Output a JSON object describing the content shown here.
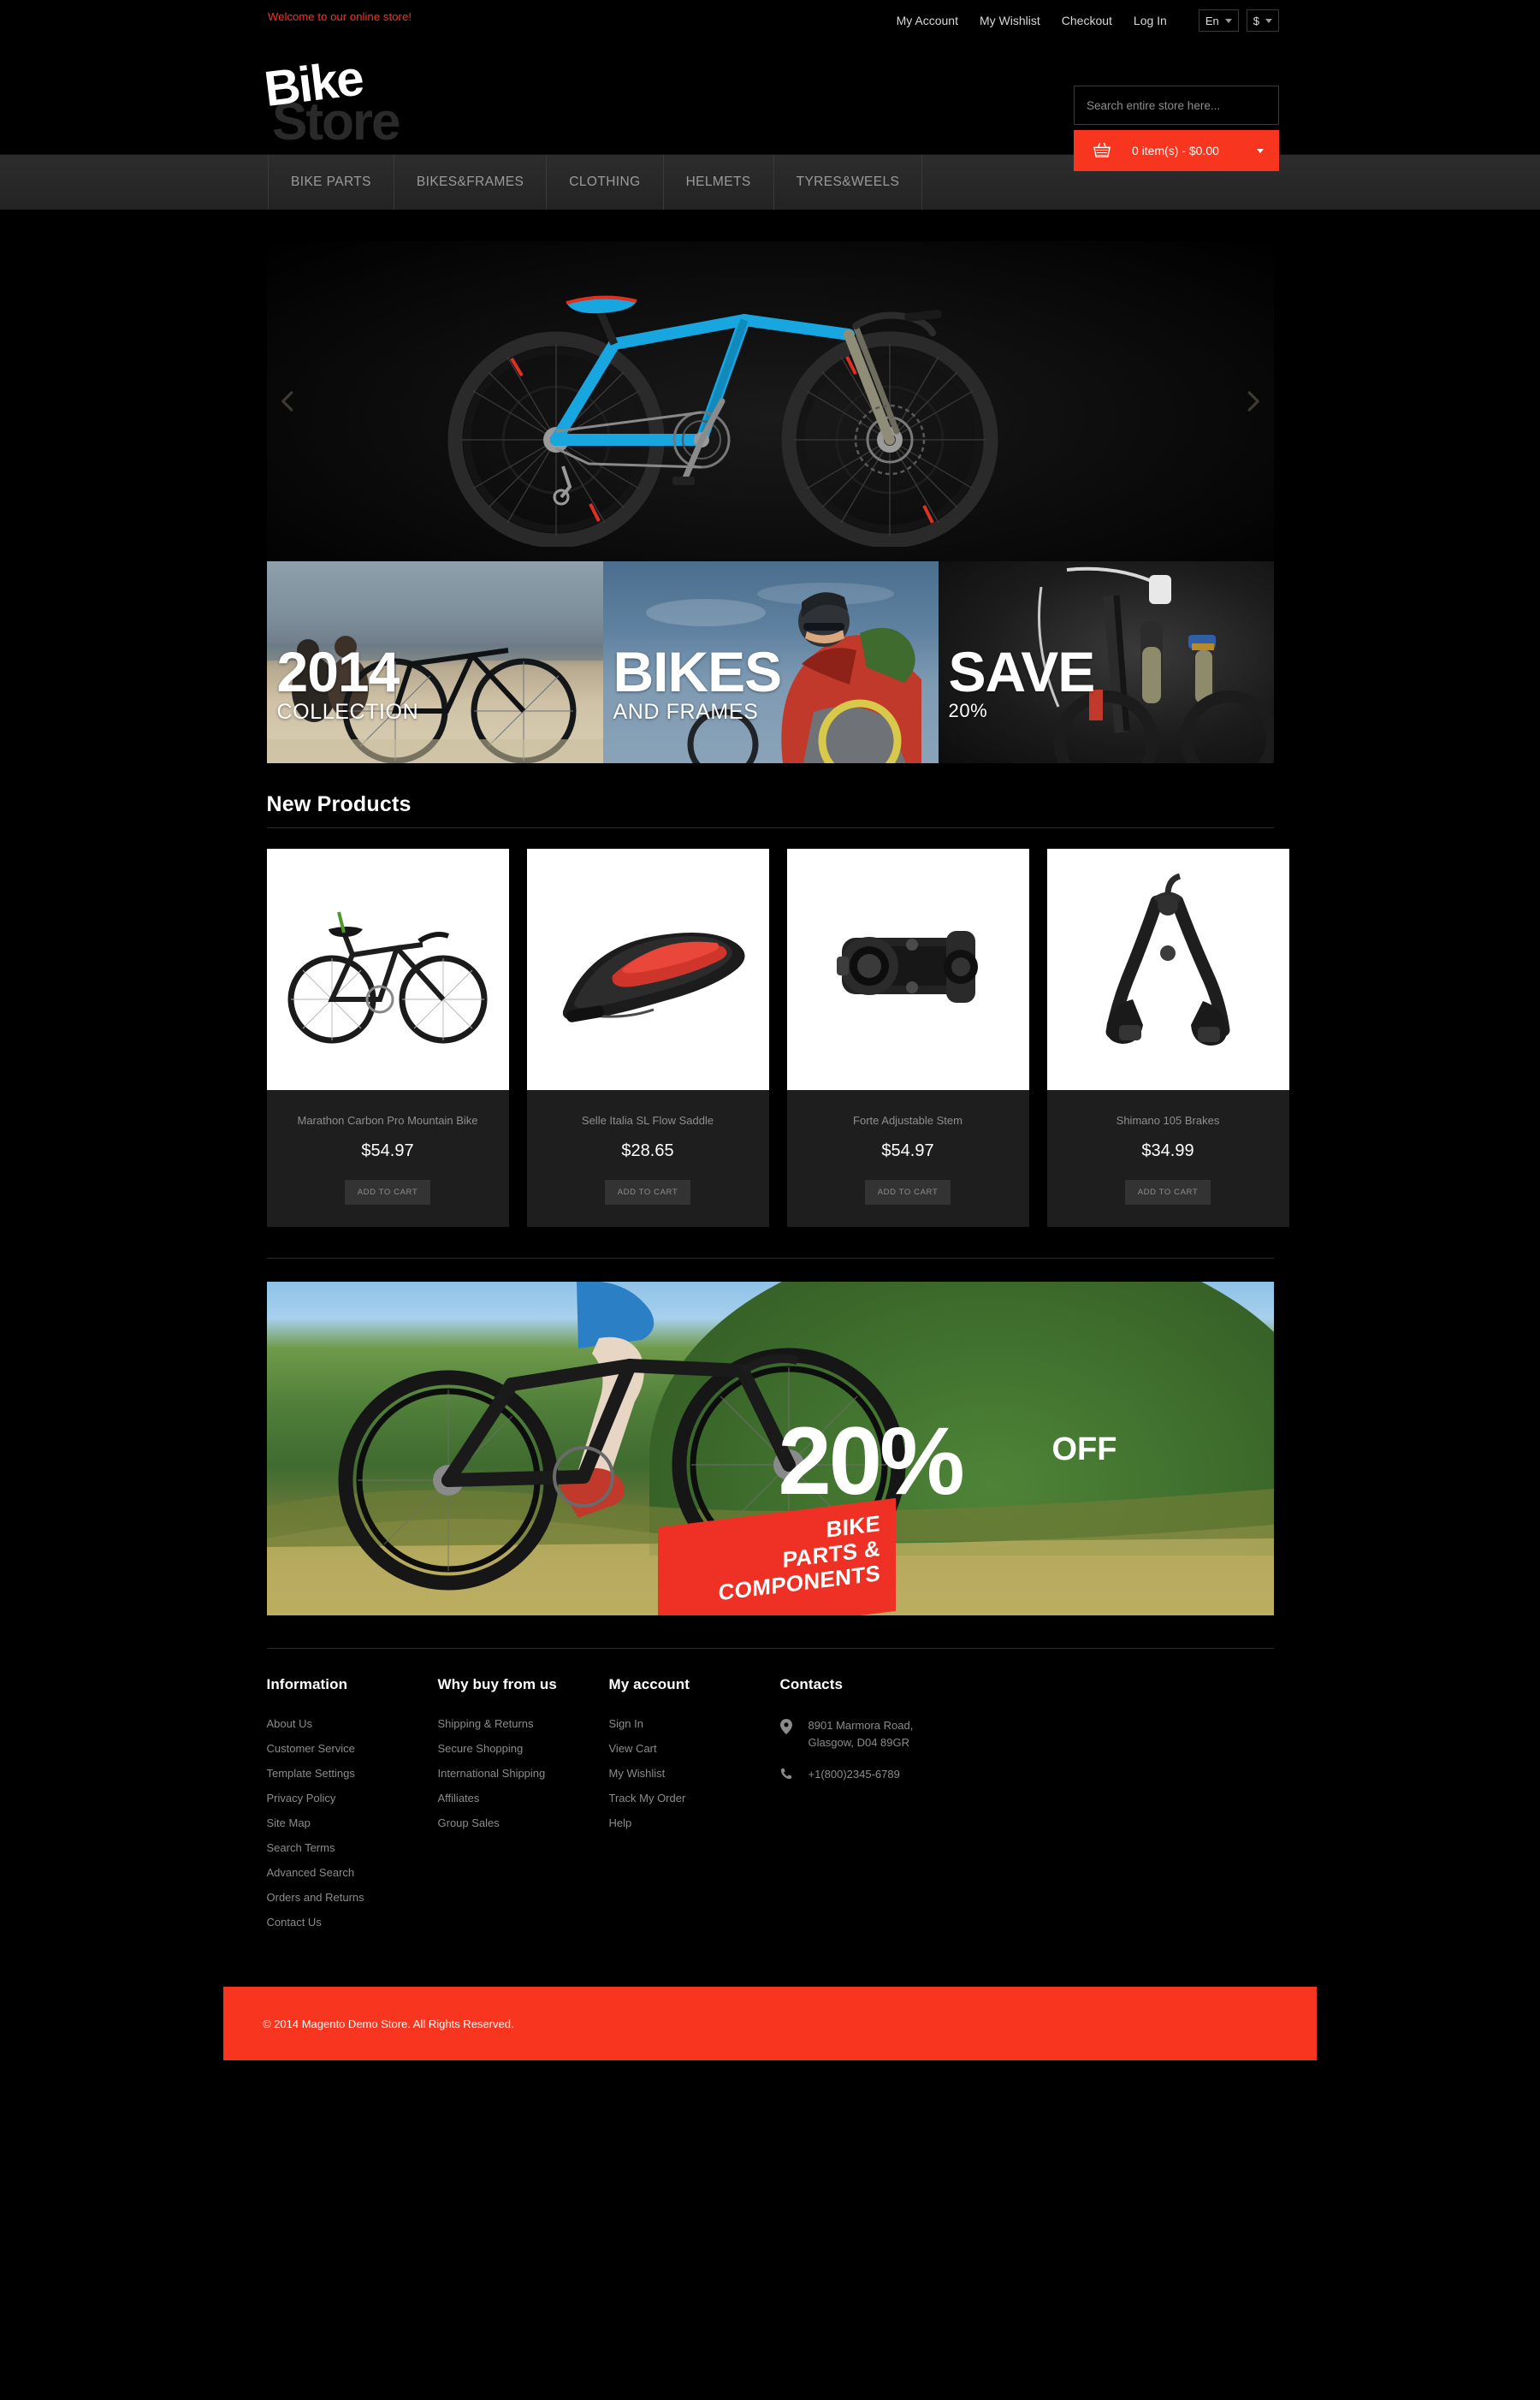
{
  "topbar": {
    "welcome": "Welcome to our online store!",
    "links": [
      {
        "label": "My Account"
      },
      {
        "label": "My Wishlist"
      },
      {
        "label": "Checkout"
      },
      {
        "label": "Log In"
      }
    ],
    "language": "En",
    "currency": "$"
  },
  "header": {
    "logo_primary": "Bike",
    "logo_secondary": "Store",
    "search_placeholder": "Search entire store here...",
    "search_value": "",
    "cart_label": "0 item(s) - $0.00",
    "cart_icon": "basket-icon"
  },
  "nav": {
    "items": [
      {
        "label": "BIKE PARTS"
      },
      {
        "label": "BIKES&FRAMES"
      },
      {
        "label": "CLOTHING"
      },
      {
        "label": "HELMETS"
      },
      {
        "label": "TYRES&WEELS"
      }
    ]
  },
  "hero": {
    "prev_icon": "chevron-left-icon",
    "next_icon": "chevron-right-icon",
    "slide_alt": "blue cube mountain bike"
  },
  "tiles": [
    {
      "big": "2014",
      "sub": "COLLECTION",
      "alt": "cyclists at the beach"
    },
    {
      "big": "BIKES",
      "sub": "AND FRAMES",
      "alt": "rider in red jersey"
    },
    {
      "big": "SAVE",
      "sub": "20%",
      "alt": "dark bike close-up"
    }
  ],
  "new_products": {
    "title": "New Products",
    "add_to_cart_label": "ADD TO CART",
    "items": [
      {
        "name": "Marathon Carbon Pro Mountain Bike",
        "price": "$54.97",
        "image": "mountain-bike"
      },
      {
        "name": "Selle Italia SL Flow Saddle",
        "price": "$28.65",
        "image": "bike-saddle"
      },
      {
        "name": "Forte Adjustable Stem",
        "price": "$54.97",
        "image": "bike-stem"
      },
      {
        "name": "Shimano 105 Brakes",
        "price": "$34.99",
        "image": "bike-brakes"
      }
    ]
  },
  "promo": {
    "percent": "20%",
    "off": "OFF",
    "badge_line1": "BIKE",
    "badge_line2": "PARTS &",
    "badge_line3": "COMPONENTS",
    "alt": "mountain biker on green hills"
  },
  "footer": {
    "columns": [
      {
        "title": "Information",
        "links": [
          {
            "label": "About Us"
          },
          {
            "label": "Customer Service"
          },
          {
            "label": "Template Settings"
          },
          {
            "label": "Privacy Policy"
          },
          {
            "label": "Site Map"
          },
          {
            "label": "Search Terms"
          },
          {
            "label": "Advanced Search"
          },
          {
            "label": "Orders and Returns"
          },
          {
            "label": "Contact Us"
          }
        ]
      },
      {
        "title": "Why buy from us",
        "links": [
          {
            "label": "Shipping & Returns"
          },
          {
            "label": "Secure Shopping"
          },
          {
            "label": "International Shipping"
          },
          {
            "label": "Affiliates"
          },
          {
            "label": "Group Sales"
          }
        ]
      },
      {
        "title": "My account",
        "links": [
          {
            "label": "Sign In"
          },
          {
            "label": "View Cart"
          },
          {
            "label": "My Wishlist"
          },
          {
            "label": "Track My Order"
          },
          {
            "label": "Help"
          }
        ]
      }
    ],
    "contacts": {
      "title": "Contacts",
      "address_line1": "8901 Marmora Road,",
      "address_line2": "Glasgow, D04 89GR",
      "phone": "+1(800)2345-6789",
      "address_icon": "map-pin-icon",
      "phone_icon": "phone-icon"
    }
  },
  "copyright": {
    "text": "© 2014 Magento Demo Store. All Rights Reserved."
  },
  "colors": {
    "accent_red": "#f8351f",
    "page_bg": "#000000",
    "card_bg": "#1e1e1e",
    "nav_bg": "#2d2d2d",
    "muted_text": "#8b8b8b"
  }
}
